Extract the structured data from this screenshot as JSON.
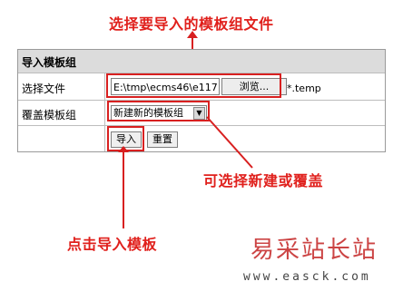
{
  "annotations": {
    "top": "选择要导入的模板组文件",
    "right": "可选择新建或覆盖",
    "bottom": "点击导入模板"
  },
  "form": {
    "title": "导入模板组",
    "file_label": "选择文件",
    "file_value": "E:\\tmp\\ecms46\\e117",
    "browse_label": "浏览...",
    "file_ext": "*.temp",
    "overwrite_label": "覆盖模板组",
    "overwrite_selected": "新建新的模板组",
    "import_label": "导入",
    "reset_label": "重置"
  },
  "watermark": {
    "name": "易采站长站",
    "url": "www.easck.com"
  },
  "colors": {
    "accent": "#d82020",
    "header_bg": "#dcdcdc"
  }
}
